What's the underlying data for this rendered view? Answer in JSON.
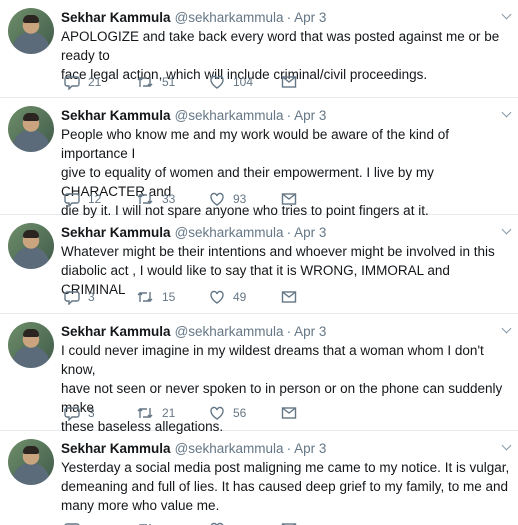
{
  "user": {
    "name": "Sekhar Kammula",
    "handle": "@sekharkammula"
  },
  "icons": [
    "reply-icon",
    "retweet-icon",
    "like-icon",
    "direct-message-icon",
    "chevron-down-icon"
  ],
  "colors": {
    "text": "#14171a",
    "muted": "#657786",
    "divider": "#e6ecf0"
  },
  "tweets": [
    {
      "date": "Apr 3",
      "lines": [
        "APOLOGIZE and take back every word that was posted against me or be  ready to",
        "face legal action, which will include criminal/civil  proceedings."
      ],
      "replies": "21",
      "retweets": "51",
      "likes": "104"
    },
    {
      "date": "Apr 3",
      "lines": [
        "People who know me and my work would be aware of the kind of importance I",
        "give to equality of women and their empowerment. I live by my CHARACTER  and",
        "die by it. I will not spare anyone who tries to point fingers at  it."
      ],
      "replies": "12",
      "retweets": "33",
      "likes": "93"
    },
    {
      "date": "Apr 3",
      "lines": [
        "Whatever might be their intentions and whoever might be involved in this",
        "diabolic act , I would like to say that it is WRONG, IMMORAL and  CRIMINAL"
      ],
      "replies": "3",
      "retweets": "15",
      "likes": "49"
    },
    {
      "date": "Apr 3",
      "lines": [
        "I could never imagine in my wildest dreams that a woman whom I don't  know,",
        "have not seen or never spoken to in person or on the phone can  suddenly make",
        "these baseless allegations."
      ],
      "replies": "3",
      "retweets": "21",
      "likes": "56"
    },
    {
      "date": "Apr 3",
      "lines": [
        "Yesterday a social media post maligning me came to my notice. It is  vulgar,",
        "demeaning and full of lies. It has caused deep grief to my  family, to me  and",
        "many more who value me."
      ],
      "replies": "",
      "retweets": "",
      "likes": ""
    }
  ]
}
